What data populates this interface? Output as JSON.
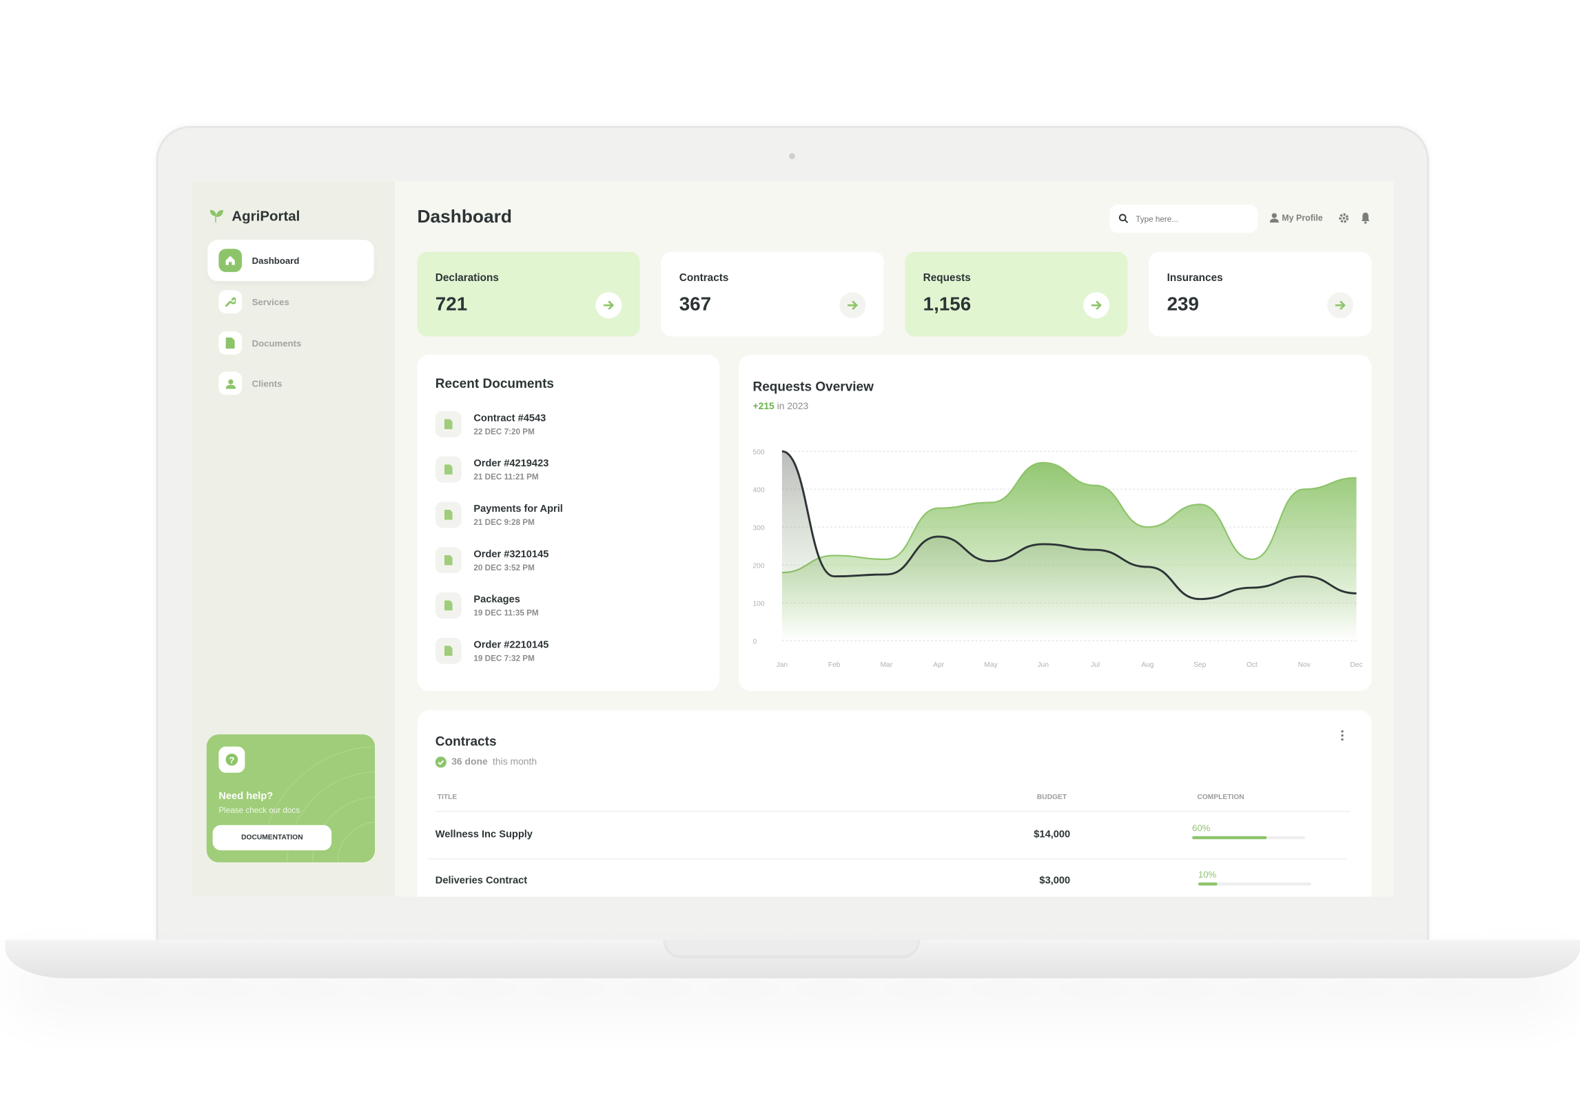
{
  "app": {
    "name": "AgriPortal"
  },
  "sidebar": {
    "items": [
      {
        "label": "Dashboard",
        "icon": "home-icon",
        "active": true
      },
      {
        "label": "Services",
        "icon": "wrench-icon"
      },
      {
        "label": "Documents",
        "icon": "document-icon"
      },
      {
        "label": "Clients",
        "icon": "user-icon"
      }
    ],
    "help": {
      "title": "Need help?",
      "subtitle": "Please check our docs",
      "button": "DOCUMENTATION"
    }
  },
  "header": {
    "title": "Dashboard",
    "search_placeholder": "Type here...",
    "profile": "My Profile"
  },
  "stats": [
    {
      "label": "Declarations",
      "value": "721"
    },
    {
      "label": "Contracts",
      "value": "367"
    },
    {
      "label": "Requests",
      "value": "1,156"
    },
    {
      "label": "Insurances",
      "value": "239"
    }
  ],
  "recent": {
    "title": "Recent Documents",
    "items": [
      {
        "name": "Contract #4543",
        "date": "22 DEC 7:20 PM"
      },
      {
        "name": "Order #4219423",
        "date": "21 DEC 11:21 PM"
      },
      {
        "name": "Payments for April",
        "date": "21 DEC 9:28 PM"
      },
      {
        "name": "Order #3210145",
        "date": "20 DEC 3:52 PM"
      },
      {
        "name": "Packages",
        "date": "19 DEC 11:35 PM"
      },
      {
        "name": "Order #2210145",
        "date": "19 DEC 7:32 PM"
      }
    ]
  },
  "chart_data": {
    "type": "area",
    "title": "Requests Overview",
    "subtitle_value": "+215",
    "subtitle_rest": "in 2023",
    "categories": [
      "Jan",
      "Feb",
      "Mar",
      "Apr",
      "May",
      "Jun",
      "Jul",
      "Aug",
      "Sep",
      "Oct",
      "Nov",
      "Dec"
    ],
    "yticks": [
      "0",
      "100",
      "200",
      "300",
      "400",
      "500"
    ],
    "ylim": [
      0,
      500
    ],
    "grid": true,
    "series": [
      {
        "color": "#8dc46a",
        "values": [
          180,
          225,
          215,
          350,
          365,
          470,
          410,
          300,
          360,
          215,
          400,
          430
        ]
      },
      {
        "color": "#2d3436",
        "values": [
          500,
          170,
          175,
          275,
          210,
          255,
          240,
          195,
          110,
          140,
          170,
          125
        ]
      }
    ]
  },
  "contracts": {
    "title": "Contracts",
    "done": "36 done",
    "done_rest": "this month",
    "columns": [
      "TITLE",
      "BUDGET",
      "COMPLETION"
    ],
    "rows": [
      {
        "title": "Wellness Inc Supply",
        "budget": "$14,000",
        "completion": "60%",
        "pct": 60
      },
      {
        "title": "Deliveries Contract",
        "budget": "$3,000",
        "completion": "10%",
        "pct": 10
      }
    ]
  },
  "colors": {
    "accent": "#8dc46a",
    "card_green": "#e1f5d1"
  }
}
